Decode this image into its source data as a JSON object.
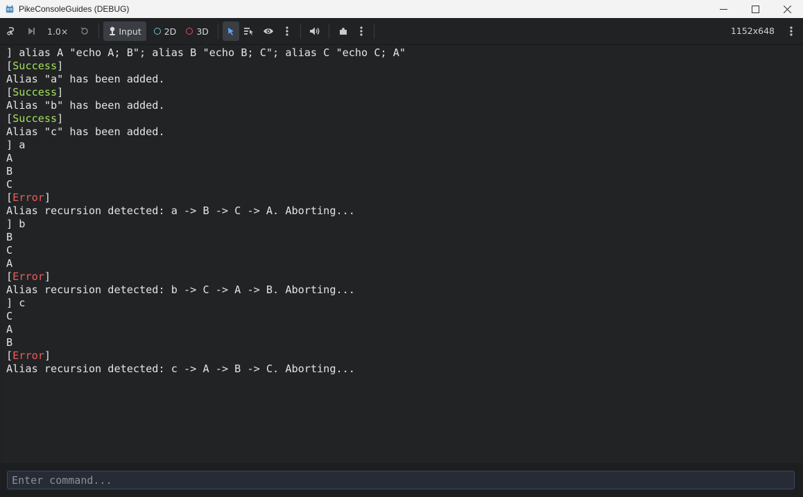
{
  "window": {
    "title": "PikeConsoleGuides (DEBUG)",
    "controls": {
      "minimize": "—",
      "maximize": "☐",
      "close": "✕"
    }
  },
  "toolbar": {
    "zoom": "1.0×",
    "input_label": "Input",
    "mode_2d": "2D",
    "mode_3d": "3D",
    "resolution": "1152x648",
    "colors": {
      "mode_2d": "#6fc2d8",
      "mode_3d": "#e0505a",
      "select_active": "#5aa6ff"
    }
  },
  "console": {
    "lines": [
      {
        "prefix": "] alias A \"echo A; B\"; alias B \"echo B; C\"; alias C \"echo C; A\"",
        "tag": "",
        "suffix": ""
      },
      {
        "prefix": "[",
        "tag": "Success",
        "suffix": "]",
        "tag_type": "success"
      },
      {
        "prefix": "Alias \"a\" has been added.",
        "tag": "",
        "suffix": ""
      },
      {
        "prefix": "[",
        "tag": "Success",
        "suffix": "]",
        "tag_type": "success"
      },
      {
        "prefix": "Alias \"b\" has been added.",
        "tag": "",
        "suffix": ""
      },
      {
        "prefix": "[",
        "tag": "Success",
        "suffix": "]",
        "tag_type": "success"
      },
      {
        "prefix": "Alias \"c\" has been added.",
        "tag": "",
        "suffix": ""
      },
      {
        "prefix": "] a",
        "tag": "",
        "suffix": ""
      },
      {
        "prefix": "A",
        "tag": "",
        "suffix": ""
      },
      {
        "prefix": "B",
        "tag": "",
        "suffix": ""
      },
      {
        "prefix": "C",
        "tag": "",
        "suffix": ""
      },
      {
        "prefix": "[",
        "tag": "Error",
        "suffix": "]",
        "tag_type": "error"
      },
      {
        "prefix": "Alias recursion detected: a -> B -> C -> A. Aborting...",
        "tag": "",
        "suffix": ""
      },
      {
        "prefix": "] b",
        "tag": "",
        "suffix": ""
      },
      {
        "prefix": "B",
        "tag": "",
        "suffix": ""
      },
      {
        "prefix": "C",
        "tag": "",
        "suffix": ""
      },
      {
        "prefix": "A",
        "tag": "",
        "suffix": ""
      },
      {
        "prefix": "[",
        "tag": "Error",
        "suffix": "]",
        "tag_type": "error"
      },
      {
        "prefix": "Alias recursion detected: b -> C -> A -> B. Aborting...",
        "tag": "",
        "suffix": ""
      },
      {
        "prefix": "] c",
        "tag": "",
        "suffix": ""
      },
      {
        "prefix": "C",
        "tag": "",
        "suffix": ""
      },
      {
        "prefix": "A",
        "tag": "",
        "suffix": ""
      },
      {
        "prefix": "B",
        "tag": "",
        "suffix": ""
      },
      {
        "prefix": "[",
        "tag": "Error",
        "suffix": "]",
        "tag_type": "error"
      },
      {
        "prefix": "Alias recursion detected: c -> A -> B -> C. Aborting...",
        "tag": "",
        "suffix": ""
      }
    ]
  },
  "command_input": {
    "value": "",
    "placeholder": "Enter command..."
  }
}
